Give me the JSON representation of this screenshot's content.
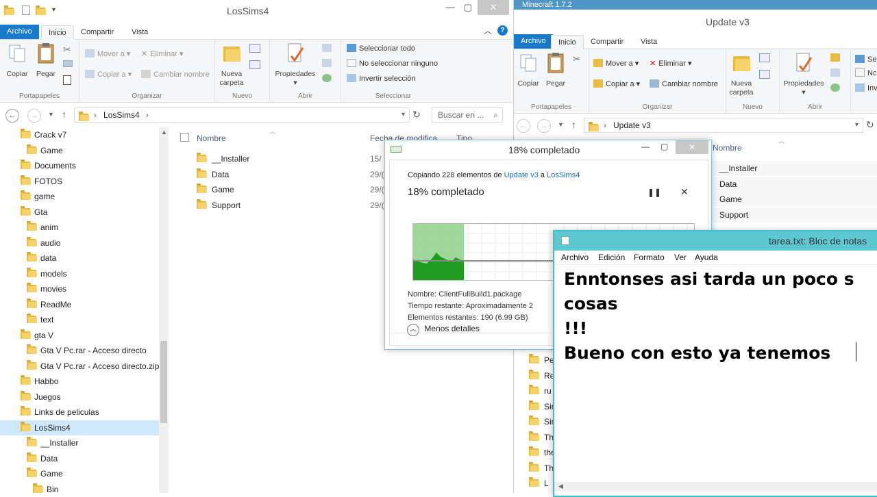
{
  "left_explorer": {
    "title": "LosSims4",
    "tabs": [
      "Archivo",
      "Inicio",
      "Compartir",
      "Vista"
    ],
    "ribbon": {
      "groups": [
        "Portapapeles",
        "Organizar",
        "Nuevo",
        "Abrir",
        "Seleccionar"
      ],
      "copy": "Copiar",
      "paste": "Pegar",
      "move_to": "Mover a",
      "copy_to": "Copiar a",
      "delete": "Eliminar",
      "rename": "Cambiar nombre",
      "new_folder_1": "Nueva",
      "new_folder_2": "carpeta",
      "properties": "Propiedades",
      "select_all": "Seleccionar todo",
      "select_none": "No seleccionar ninguno",
      "invert_selection": "Invertir selección"
    },
    "address": "LosSims4",
    "search_placeholder": "Buscar en ...",
    "columns": {
      "name": "Nombre",
      "date": "Fecha de modifica...",
      "type": "Tipo"
    },
    "files": [
      {
        "name": "__Installer",
        "date": "15/"
      },
      {
        "name": "Data",
        "date": "29/("
      },
      {
        "name": "Game",
        "date": "29/("
      },
      {
        "name": "Support",
        "date": "29/("
      }
    ],
    "tree": [
      "Crack v7",
      "Game",
      "Documents",
      "FOTOS",
      "game",
      "Gta",
      "anim",
      "audio",
      "data",
      "models",
      "movies",
      "ReadMe",
      "text",
      "gta V",
      "Gta V Pc.rar - Acceso directo",
      "Gta V Pc.rar - Acceso directo.zip",
      "Habbo",
      "Juegos",
      "Links de peliculas",
      "LosSims4",
      "__Installer",
      "Data",
      "Game",
      "Bin"
    ]
  },
  "right_explorer": {
    "top_tab_title": "Minecraft 1.7.2",
    "title": "Update v3",
    "tabs": [
      "Archivo",
      "Inicio",
      "Compartir",
      "Vista"
    ],
    "ribbon": {
      "groups": [
        "Portapapeles",
        "Organizar",
        "Nuevo",
        "Abrir"
      ],
      "copy": "Copiar",
      "paste": "Pegar",
      "move_to": "Mover a",
      "copy_to": "Copiar a",
      "delete": "Eliminar",
      "rename": "Cambiar nombre",
      "new_folder_1": "Nueva",
      "new_folder_2": "carpeta",
      "properties": "Propiedades",
      "partial_1": "Se",
      "partial_2": "Nc",
      "partial_3": "Inv"
    },
    "address": "Update v3",
    "column_name": "Nombre",
    "files": [
      "__Installer",
      "Data",
      "Game",
      "Support"
    ],
    "partial_rows": [
      "Pe",
      "Re",
      "ru",
      "Sir",
      "Sir",
      "Th",
      "the",
      "Th",
      "L"
    ]
  },
  "copy_dialog": {
    "title": "18% completado",
    "copying_prefix": "Copiando 228 elementos de",
    "source": "Update v3",
    "connector": "a",
    "destination": "LosSims4",
    "progress_heading": "18% completado",
    "progress_percent": 18,
    "name_line": "Nombre: ClientFullBuild1.package",
    "time_line": "Tiempo restante: Aproximadamente 2",
    "items_line": "Elementos restantes: 190 (6.99 GB)",
    "less_details": "Menos detalles",
    "pause_icon": "pause-icon",
    "close_icon": "close-icon"
  },
  "notepad": {
    "title": "tarea.txt: Bloc de notas",
    "menu": [
      "Archivo",
      "Edición",
      "Formato",
      "Ver",
      "Ayuda"
    ],
    "content": "Enntonses asi tarda un poco s\ncosas\n!!!\nBueno con esto ya tenemos "
  }
}
